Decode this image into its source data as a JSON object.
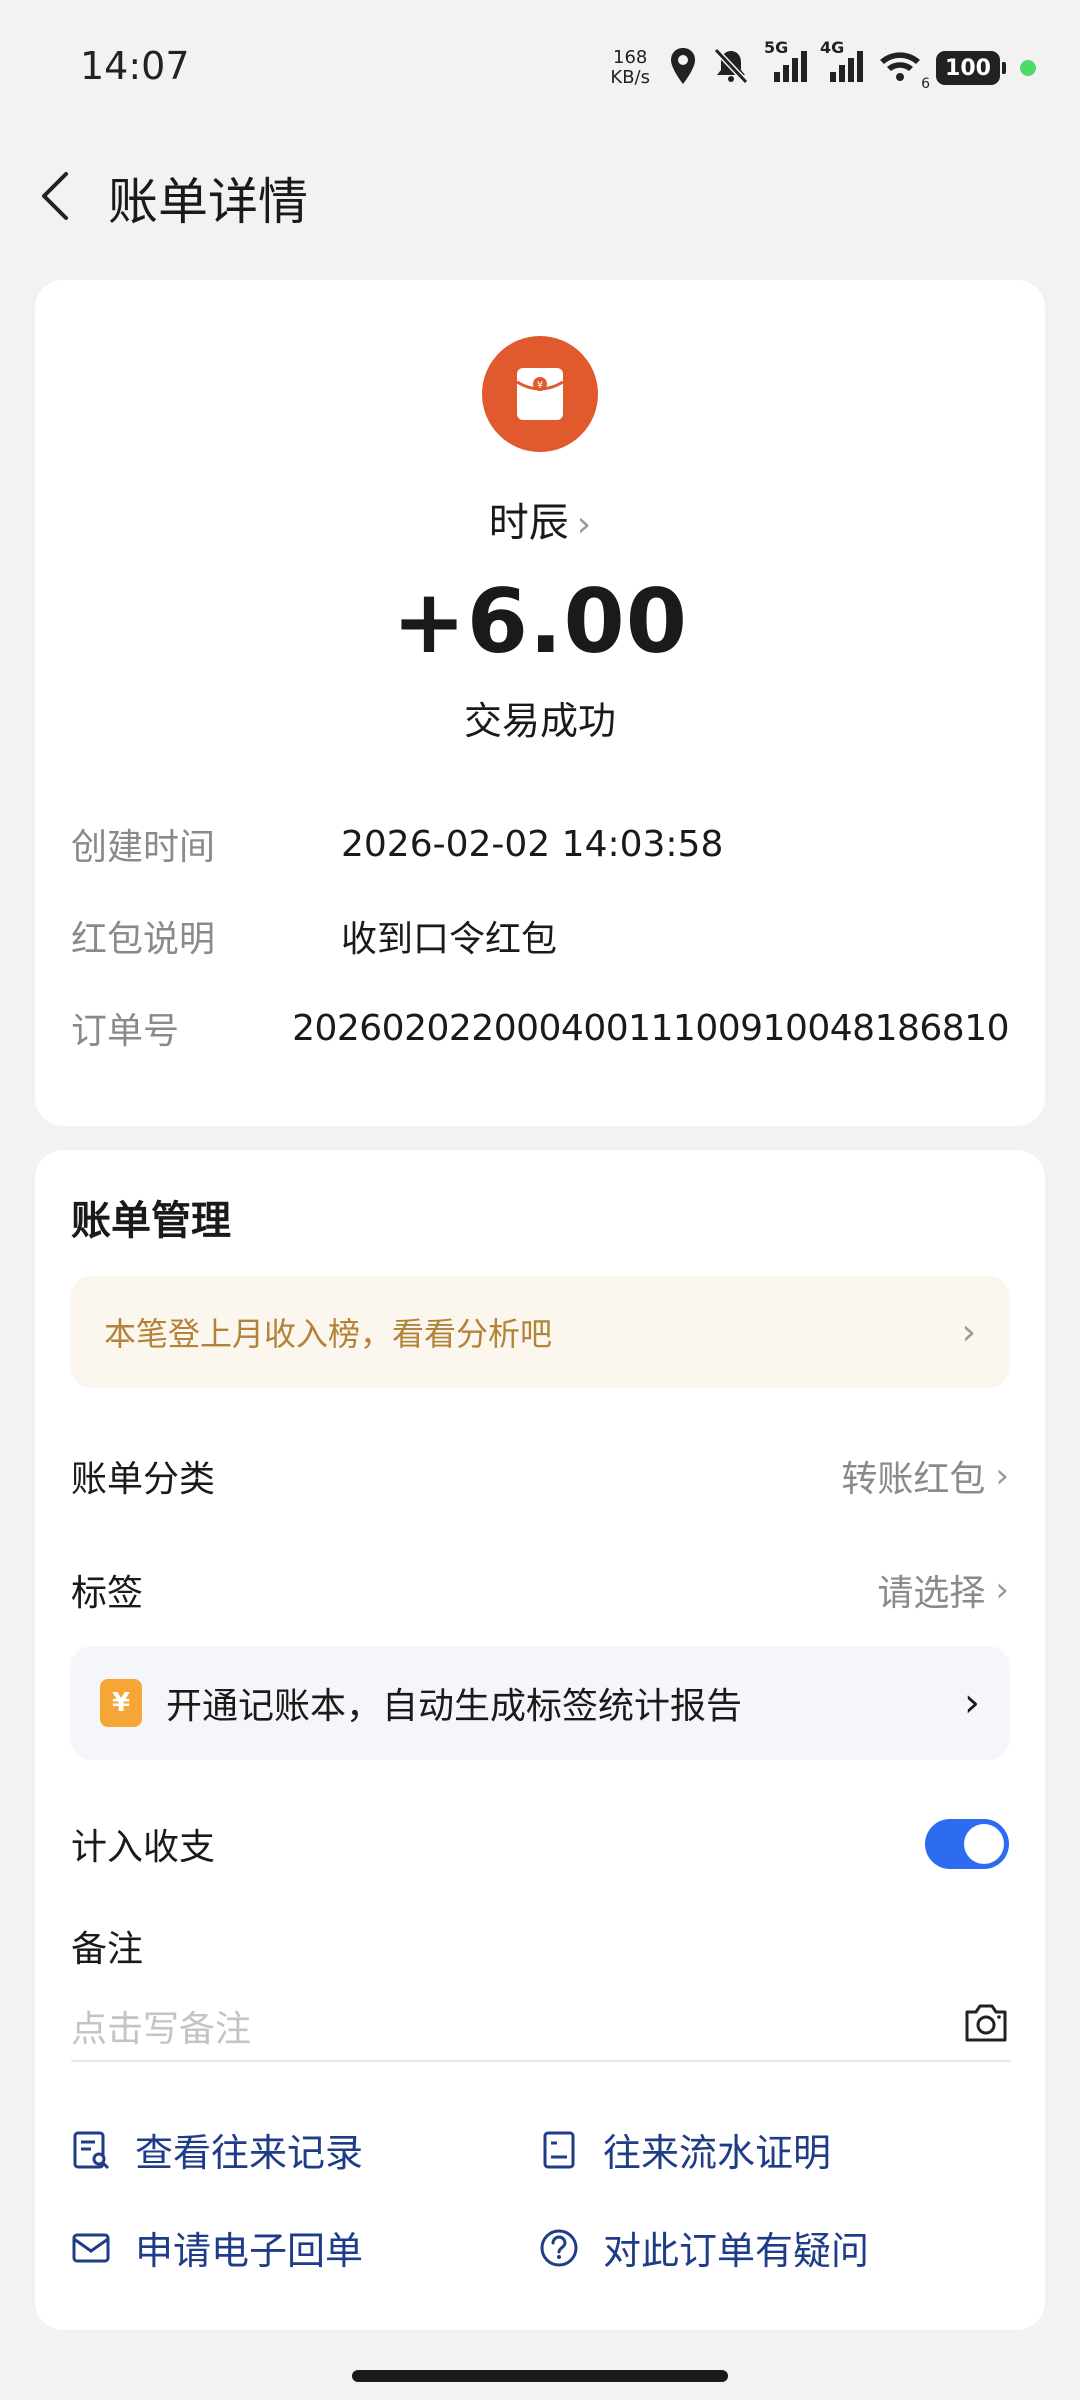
{
  "status_bar": {
    "time": "14:07",
    "net_speed_value": "168",
    "net_speed_unit": "KB/s",
    "signal_1": "5G",
    "signal_2": "4G",
    "wifi_sub": "6",
    "battery": "100"
  },
  "header": {
    "title": "账单详情"
  },
  "transaction": {
    "payer": "时辰",
    "amount": "+6.00",
    "status": "交易成功",
    "details": [
      {
        "label": "创建时间",
        "value": "2026-02-02 14:03:58"
      },
      {
        "label": "红包说明",
        "value": "收到口令红包"
      },
      {
        "label": "订单号",
        "value": "20260202200040011100910048186810"
      }
    ]
  },
  "management": {
    "title": "账单管理",
    "promo": "本笔登上月收入榜，看看分析吧",
    "category_label": "账单分类",
    "category_value": "转账红包",
    "tag_label": "标签",
    "tag_value": "请选择",
    "banner_icon": "¥",
    "banner_text": "开通记账本，自动生成标签统计报告",
    "include_label": "计入收支",
    "include_enabled": true,
    "note_label": "备注",
    "note_placeholder": "点击写备注"
  },
  "links": {
    "records": "查看往来记录",
    "proof": "往来流水证明",
    "receipt": "申请电子回单",
    "question": "对此订单有疑问"
  },
  "colors": {
    "accent": "#2d6cf0",
    "avatar": "#e05a2d",
    "link": "#1f3c88",
    "promo_text": "#b38338"
  }
}
